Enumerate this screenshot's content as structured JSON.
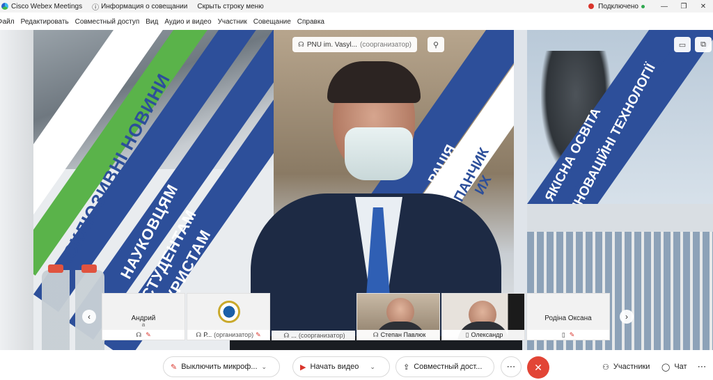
{
  "titlebar": {
    "app_name": "Cisco Webex Meetings",
    "meeting_info": "Информация о совещании",
    "hide_menu": "Скрыть строку меню",
    "status": "Подключено"
  },
  "menu": {
    "items": [
      "Файл",
      "Редактировать",
      "Совместный доступ",
      "Вид",
      "Аудио и видео",
      "Участник",
      "Совещание",
      "Справка"
    ]
  },
  "stage": {
    "active_speaker_name": "PNU im. Vasyl...",
    "active_speaker_role": "(соорганизатор)",
    "banners": {
      "left_title": "ЕКСКЛЮЗИВНІ НОВИНИ",
      "left_line1": "НАУКОВЦЯМ",
      "left_line2": "СТУДЕНТАМ",
      "left_line3": "ТУРИСТАМ",
      "middle_line1": "РАЦІЯ",
      "middle_line2": "ПАНЧИК",
      "middle_line3": "ИХ",
      "right_line1": "ЯКІСНА ОСВІТА",
      "right_line2": "ІННОВАЦІЙНІ ТЕХНОЛОГІЇ"
    }
  },
  "thumbnails": [
    {
      "name": "Андрий",
      "mute_note": "a",
      "bar_name": "",
      "role": ""
    },
    {
      "name": "",
      "mute_note": "",
      "bar_name": "Р...",
      "role": "(организатор)"
    },
    {
      "name": "",
      "mute_note": "",
      "bar_name": "...",
      "role": "(соорганизатор)"
    },
    {
      "name": "",
      "mute_note": "",
      "bar_name": "Степан Павлюк",
      "role": ""
    },
    {
      "name": "",
      "mute_note": "",
      "bar_name": "Олександр",
      "role": ""
    },
    {
      "name": "Родіна Оксана",
      "mute_note": "",
      "bar_name": "",
      "role": ""
    }
  ],
  "toolbar": {
    "mute_label": "Выключить микроф...",
    "video_label": "Начать видео",
    "share_label": "Совместный дост...",
    "more_label": "⋯",
    "end_label": "✕",
    "participants_label": "Участники",
    "chat_label": "Чат",
    "overflow_label": "⋯"
  },
  "colors": {
    "accent_red": "#e24536",
    "banner_blue": "#2d4f9a",
    "banner_green": "#5ab34a"
  }
}
